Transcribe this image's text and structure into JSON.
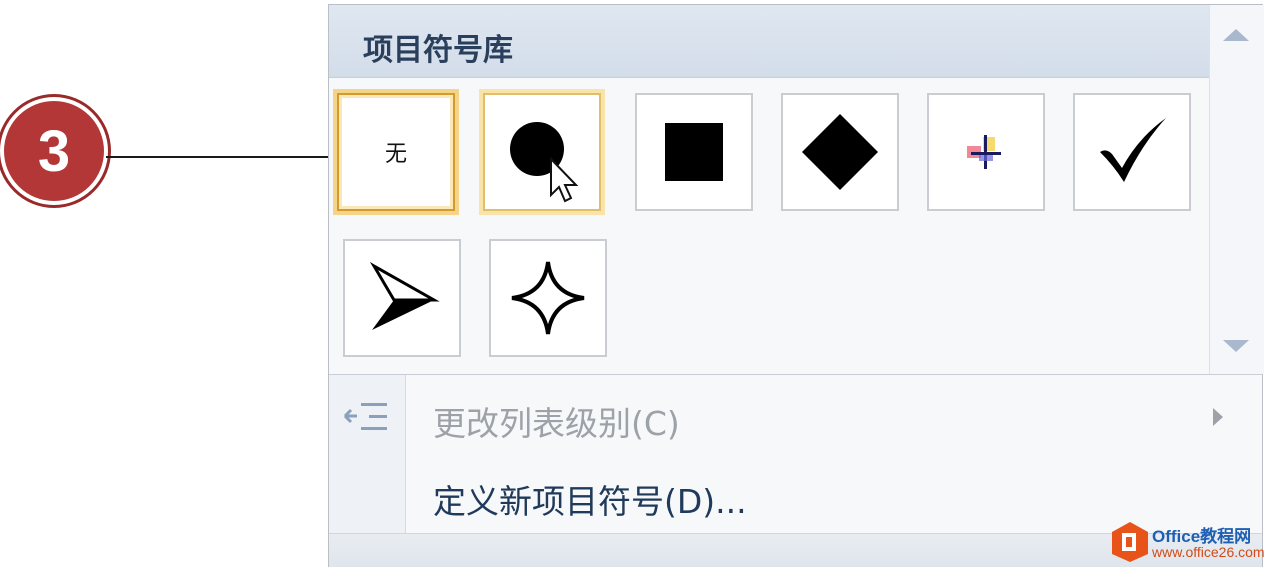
{
  "callout": {
    "number": "3"
  },
  "gallery": {
    "title": "项目符号库",
    "items": [
      {
        "name": "none",
        "label": "无",
        "icon": "none-text"
      },
      {
        "name": "filled-circle",
        "icon": "filled-circle-icon"
      },
      {
        "name": "filled-square",
        "icon": "filled-square-icon"
      },
      {
        "name": "filled-diamond",
        "icon": "filled-diamond-icon"
      },
      {
        "name": "cross-color",
        "icon": "color-cross-icon"
      },
      {
        "name": "checkmark",
        "icon": "checkmark-icon"
      },
      {
        "name": "arrowhead",
        "icon": "arrowhead-icon"
      },
      {
        "name": "four-point-star",
        "icon": "four-point-star-icon"
      }
    ]
  },
  "menu": {
    "change_level": "更改列表级别(C)",
    "define_new": "定义新项目符号(D)..."
  },
  "watermark": {
    "title": "Office教程网",
    "url": "www.office26.com"
  },
  "colors": {
    "selected_border": "#d49a2a",
    "header_text": "#2a3f5c",
    "callout": "#b33737"
  }
}
